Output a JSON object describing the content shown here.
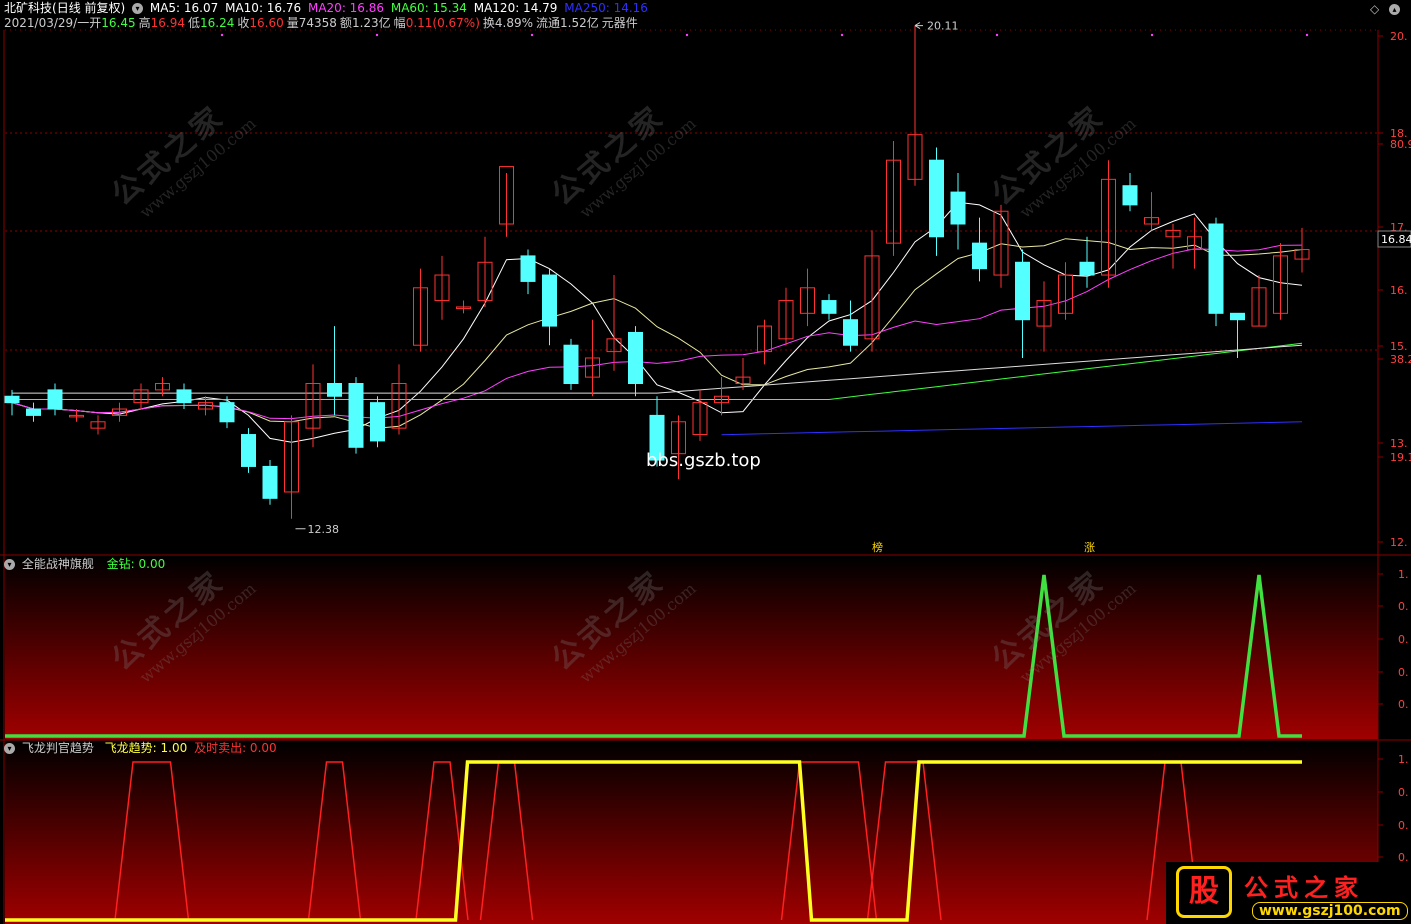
{
  "stock": {
    "name": "北矿科技",
    "mode": "(日线 前复权)",
    "ma": [
      {
        "label": "MA5: 16.07",
        "color": "#ffffff"
      },
      {
        "label": "MA10: 16.76",
        "color": "#ffffff"
      },
      {
        "label": "MA20: 16.86",
        "color": "#ff40ff"
      },
      {
        "label": "MA60: 15.34",
        "color": "#40ff40"
      },
      {
        "label": "MA120: 14.79",
        "color": "#ffffff"
      },
      {
        "label": "MA250: 14.16",
        "color": "#3030ff"
      }
    ]
  },
  "quote": {
    "date": "2021/03/29/一",
    "open_label": "开",
    "open": "16.45",
    "high_label": "高",
    "high": "16.94",
    "low_label": "低",
    "low": "16.24",
    "close_label": "收",
    "close": "16.60",
    "vol_label": "量",
    "vol": "74358",
    "amount_label": "额",
    "amount": "1.23亿",
    "chg_label": "幅",
    "chg": "0.11(0.67%)",
    "turnover": "换4.89%",
    "float": "流通1.52亿",
    "sector": "元器件"
  },
  "markers": {
    "high": "20.11",
    "low": "12.38",
    "tag1": "榜",
    "tag2": "涨",
    "bbs": "bbs.gszb.top"
  },
  "axis": {
    "main_labels": [
      "20.",
      "18.",
      "80.9",
      "17.",
      "16.84",
      "16.",
      "15.",
      "38.2",
      "13.",
      "19.1",
      "12."
    ],
    "panel_labels": [
      "1.",
      "0.",
      "0.",
      "0.",
      "0."
    ]
  },
  "panel2": {
    "title": "全能战神旗舰",
    "series_label": "金钻: 0.00"
  },
  "panel3": {
    "title": "飞龙判官趋势",
    "series1_label": "飞龙趋势: 1.00",
    "series2_label": "及时卖出: 0.00"
  },
  "watermark": {
    "text": "公式之家",
    "url": "www.gszj100.com"
  },
  "logo": {
    "glyph": "股",
    "name": "公式之家",
    "url": "www.gszj100.com"
  },
  "colors": {
    "up": "#ff3232",
    "down": "#54ffff",
    "ma5": "#ffffff",
    "ma20": "#ff40ff",
    "ma60": "#40ff40",
    "ma250": "#3030ff",
    "grid": "#8b0000"
  },
  "chart_data": [
    {
      "type": "candlestick",
      "title": "北矿科技",
      "candles": [
        [
          14.3,
          14.2,
          14.0,
          14.4
        ],
        [
          14.1,
          14.0,
          13.9,
          14.2
        ],
        [
          14.4,
          14.1,
          14.0,
          14.5
        ],
        [
          14.0,
          14.0,
          13.9,
          14.1
        ],
        [
          13.8,
          13.9,
          13.7,
          14.0
        ],
        [
          14.0,
          14.1,
          13.9,
          14.2
        ],
        [
          14.2,
          14.4,
          14.1,
          14.5
        ],
        [
          14.4,
          14.5,
          14.3,
          14.6
        ],
        [
          14.4,
          14.2,
          14.1,
          14.5
        ],
        [
          14.1,
          14.2,
          14.0,
          14.3
        ],
        [
          14.2,
          13.9,
          13.8,
          14.3
        ],
        [
          13.7,
          13.2,
          13.1,
          13.8
        ],
        [
          13.2,
          12.7,
          12.6,
          13.3
        ],
        [
          12.8,
          13.9,
          12.38,
          14.0
        ],
        [
          13.8,
          14.5,
          13.5,
          14.8
        ],
        [
          14.5,
          14.3,
          14.0,
          15.4
        ],
        [
          14.5,
          13.5,
          13.4,
          14.6
        ],
        [
          14.2,
          13.6,
          13.5,
          14.3
        ],
        [
          13.8,
          14.5,
          13.7,
          14.8
        ],
        [
          15.1,
          16.0,
          15.0,
          16.3
        ],
        [
          15.8,
          16.2,
          15.5,
          16.5
        ],
        [
          15.7,
          15.7,
          15.6,
          15.8
        ],
        [
          15.8,
          16.4,
          15.7,
          16.8
        ],
        [
          17.0,
          17.9,
          16.8,
          17.8
        ],
        [
          16.5,
          16.1,
          15.9,
          16.6
        ],
        [
          16.2,
          15.4,
          15.1,
          16.3
        ],
        [
          15.1,
          14.5,
          14.4,
          15.2
        ],
        [
          14.6,
          14.9,
          14.3,
          15.5
        ],
        [
          15.0,
          15.2,
          14.7,
          16.2
        ],
        [
          15.3,
          14.5,
          14.3,
          15.4
        ],
        [
          14.0,
          13.3,
          13.2,
          14.3
        ],
        [
          13.4,
          13.9,
          13.0,
          14.0
        ],
        [
          13.7,
          14.2,
          13.6,
          14.4
        ],
        [
          14.2,
          14.3,
          14.0,
          14.6
        ],
        [
          14.5,
          14.6,
          14.4,
          14.9
        ],
        [
          15.0,
          15.4,
          14.8,
          15.5
        ],
        [
          15.2,
          15.8,
          15.1,
          16.0
        ],
        [
          15.6,
          16.0,
          15.4,
          16.3
        ],
        [
          15.8,
          15.6,
          15.5,
          15.9
        ],
        [
          15.5,
          15.1,
          15.0,
          15.8
        ],
        [
          15.2,
          16.5,
          15.0,
          16.9
        ],
        [
          16.7,
          18.0,
          16.5,
          18.3
        ],
        [
          17.7,
          18.4,
          17.6,
          20.11
        ],
        [
          18.0,
          16.8,
          16.5,
          18.2
        ],
        [
          17.5,
          17.0,
          16.6,
          17.8
        ],
        [
          16.7,
          16.3,
          16.1,
          17.1
        ],
        [
          16.2,
          17.2,
          16.0,
          17.3
        ],
        [
          16.4,
          15.5,
          14.9,
          16.6
        ],
        [
          15.4,
          15.8,
          15.0,
          16.1
        ],
        [
          15.6,
          16.2,
          15.5,
          16.4
        ],
        [
          16.4,
          16.2,
          16.0,
          16.8
        ],
        [
          16.2,
          17.7,
          16.0,
          18.0
        ],
        [
          17.6,
          17.3,
          17.2,
          17.8
        ],
        [
          17.0,
          17.1,
          16.9,
          17.5
        ],
        [
          16.8,
          16.9,
          16.3,
          17.0
        ],
        [
          16.6,
          16.8,
          16.3,
          17.1
        ],
        [
          17.0,
          15.6,
          15.4,
          17.1
        ],
        [
          15.6,
          15.5,
          14.9,
          15.6
        ],
        [
          15.4,
          16.0,
          15.4,
          16.2
        ],
        [
          15.6,
          16.5,
          15.5,
          16.7
        ],
        [
          16.45,
          16.6,
          16.24,
          16.94
        ]
      ],
      "ma_lines_label": [
        "MA5",
        "MA10",
        "MA20",
        "MA60",
        "MA120",
        "MA250"
      ]
    },
    {
      "type": "line",
      "title": "全能战神旗舰",
      "series": [
        {
          "name": "金钻",
          "values": [
            0,
            0,
            0,
            0,
            0,
            0,
            0,
            0,
            0,
            0,
            0,
            0,
            0,
            0,
            0,
            0,
            0,
            0,
            0,
            0,
            0,
            0,
            0,
            0,
            0,
            0,
            0,
            0,
            0,
            0,
            0,
            0,
            0,
            0,
            0,
            0,
            0,
            0,
            0,
            0,
            0,
            0,
            0,
            0,
            0,
            0,
            0,
            0,
            1,
            0,
            0,
            0,
            0,
            0,
            0,
            0,
            0,
            0,
            1,
            0,
            0
          ]
        }
      ]
    },
    {
      "type": "line",
      "title": "飞龙判官趋势",
      "series": [
        {
          "name": "飞龙趋势",
          "values": [
            0,
            0,
            0,
            0,
            0,
            0,
            0,
            0,
            0,
            0,
            0,
            0,
            0,
            0,
            0,
            0,
            0,
            0,
            0,
            0,
            0,
            1,
            1,
            1,
            1,
            1,
            1,
            1,
            1,
            1,
            1,
            1,
            1,
            1,
            1,
            1,
            1,
            0,
            0,
            0,
            0,
            0,
            1,
            1,
            1,
            1,
            1,
            1,
            1,
            1,
            1,
            1,
            1,
            1,
            1,
            1,
            1,
            1,
            1,
            1,
            1
          ]
        },
        {
          "name": "及时卖出",
          "values": [
            0,
            0,
            0,
            0,
            0,
            0,
            1,
            1,
            0,
            0,
            0,
            0,
            0,
            0,
            0,
            1,
            0,
            0,
            0,
            0,
            1,
            0,
            0,
            1,
            0,
            0,
            0,
            0,
            0,
            0,
            0,
            0,
            0,
            0,
            0,
            0,
            0,
            1,
            1,
            1,
            0,
            1,
            1,
            0,
            0,
            0,
            0,
            0,
            0,
            0,
            0,
            0,
            0,
            0,
            1,
            0,
            0,
            0,
            0,
            0,
            0
          ]
        }
      ]
    }
  ]
}
